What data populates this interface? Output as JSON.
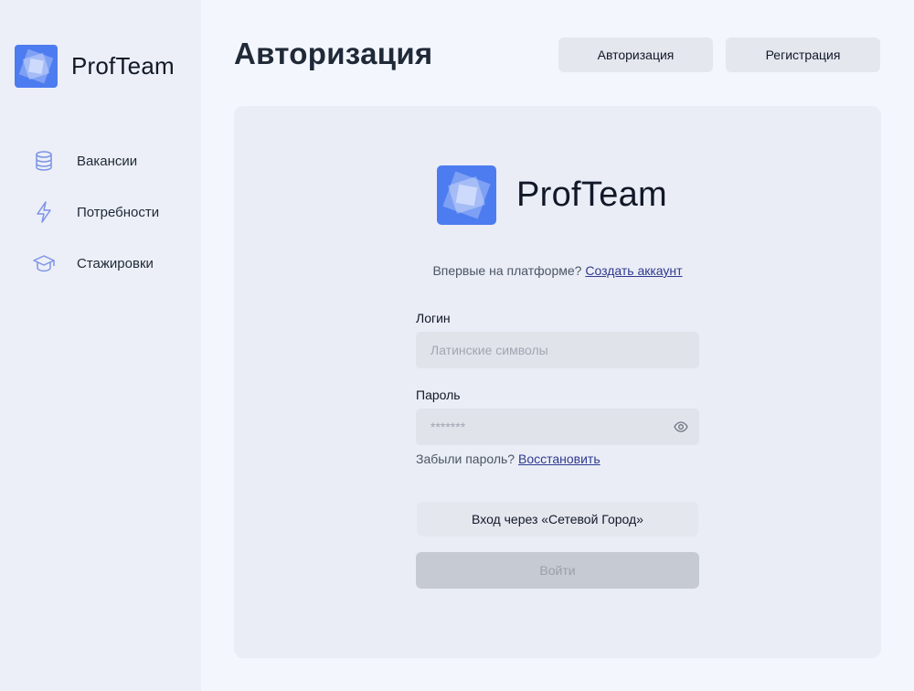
{
  "app": {
    "name": "ProfTeam"
  },
  "colors": {
    "accent": "#4f7df0",
    "link": "#2f3a8f",
    "sidebar_icon": "#7c93e6"
  },
  "sidebar": {
    "items": [
      {
        "label": "Вакансии",
        "icon": "database-icon"
      },
      {
        "label": "Потребности",
        "icon": "lightning-icon"
      },
      {
        "label": "Стажировки",
        "icon": "graduation-cap-icon"
      }
    ]
  },
  "header": {
    "title": "Авторизация",
    "auth_button": "Авторизация",
    "register_button": "Регистрация"
  },
  "form": {
    "brand": "ProfTeam",
    "first_time_text": "Впервые на платформе?",
    "create_account_link": "Создать аккаунт",
    "login_label": "Логин",
    "login_placeholder": "Латинские символы",
    "login_value": "",
    "password_label": "Пароль",
    "password_placeholder": "*******",
    "password_value": "",
    "forgot_text": "Забыли пароль?",
    "restore_link": "Восстановить",
    "city_login_button": "Вход через «Сетевой Город»",
    "submit_button": "Войти"
  }
}
